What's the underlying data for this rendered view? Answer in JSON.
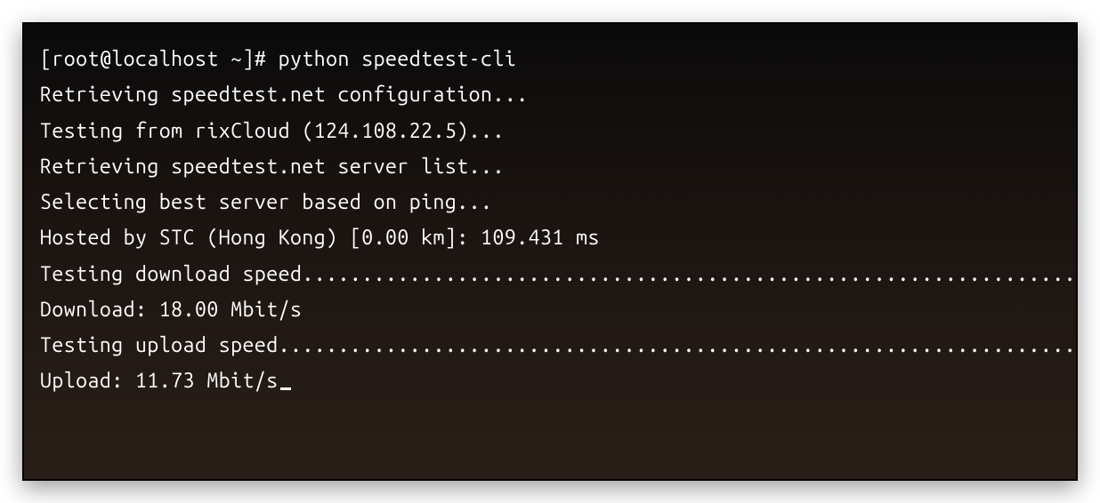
{
  "terminal": {
    "lines": [
      "[root@localhost ~]# python speedtest-cli",
      "Retrieving speedtest.net configuration...",
      "Testing from rixCloud (124.108.22.5)...",
      "Retrieving speedtest.net server list...",
      "Selecting best server based on ping...",
      "Hosted by STC (Hong Kong) [0.00 km]: 109.431 ms",
      "Testing download speed........................................................................................",
      "Download: 18.00 Mbit/s",
      "Testing upload speed..................................................................................................",
      "Upload: 11.73 Mbit/s"
    ]
  }
}
